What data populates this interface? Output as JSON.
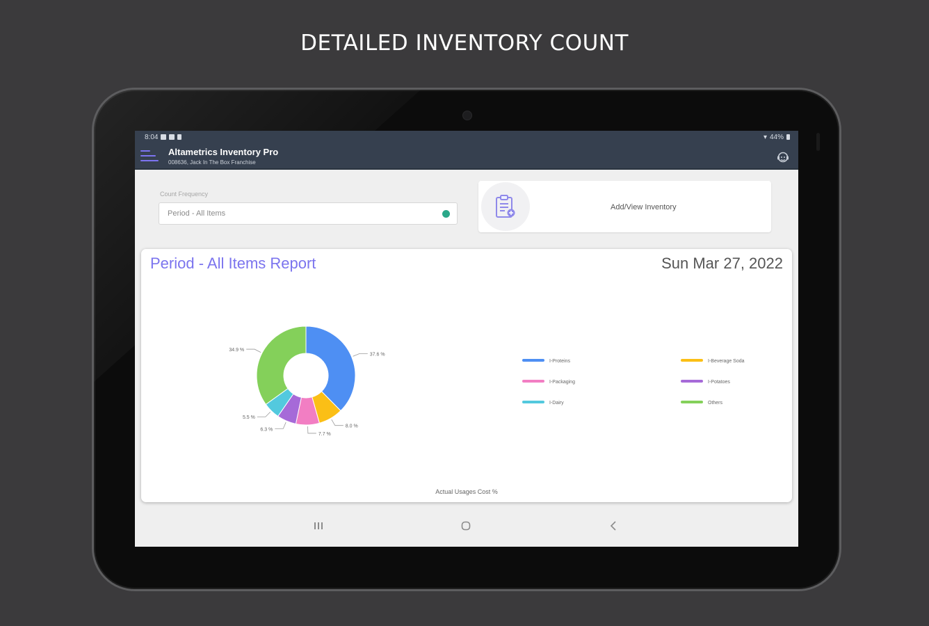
{
  "headline": "DETAILED INVENTORY COUNT",
  "status_bar": {
    "time": "8:04",
    "battery": "44%"
  },
  "app_bar": {
    "title": "Altametrics Inventory Pro",
    "subtitle": "008636, Jack In The Box Franchise"
  },
  "count_frequency": {
    "label": "Count Frequency",
    "selected": "Period - All Items"
  },
  "inventory_card": {
    "label": "Add/View Inventory"
  },
  "report": {
    "title": "Period - All Items Report",
    "date": "Sun Mar 27, 2022"
  },
  "chart_data": {
    "type": "pie",
    "xlabel": "Actual Usages Cost %",
    "legend_position": "right",
    "slices": [
      {
        "name": "I-Proteins",
        "value": 37.6,
        "label": "37.6 %",
        "color": "#4e8ff3"
      },
      {
        "name": "I-Beverage Soda",
        "value": 8.0,
        "label": "8.0 %",
        "color": "#fbbf16"
      },
      {
        "name": "I-Packaging",
        "value": 7.7,
        "label": "7.7 %",
        "color": "#f27ec3"
      },
      {
        "name": "I-Potatoes",
        "value": 6.3,
        "label": "6.3 %",
        "color": "#a66ad8"
      },
      {
        "name": "I-Dairy",
        "value": 5.5,
        "label": "5.5 %",
        "color": "#53c9de"
      },
      {
        "name": "Others",
        "value": 34.9,
        "label": "34.9 %",
        "color": "#84d05a"
      }
    ]
  }
}
